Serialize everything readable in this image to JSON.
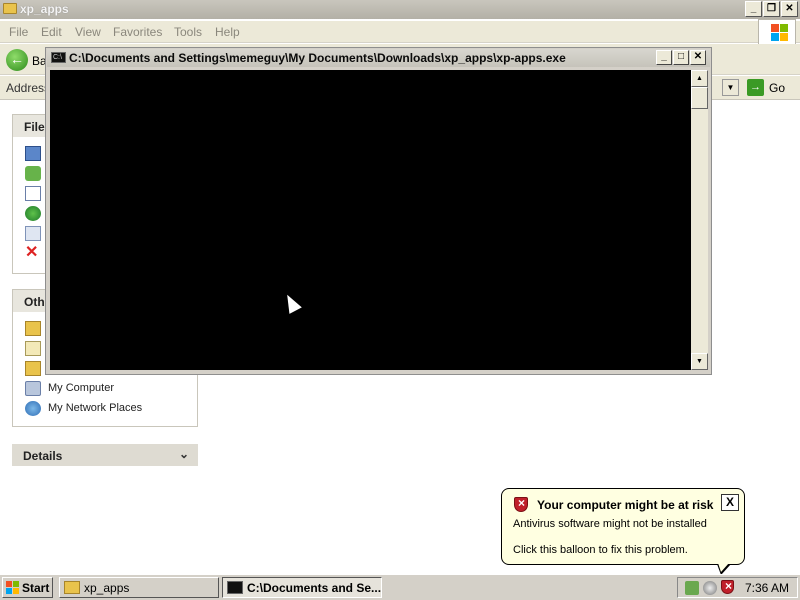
{
  "explorer": {
    "title": "xp_apps",
    "menu": [
      "File",
      "Edit",
      "View",
      "Favorites",
      "Tools",
      "Help"
    ],
    "toolbar": {
      "back_label": "Ba"
    },
    "address": {
      "label": "Address",
      "go_label": "Go"
    },
    "task_pane": {
      "file_tasks_header": "File",
      "other_places_header": "Oth",
      "other_places_items": [
        "My Computer",
        "My Network Places"
      ],
      "details_header": "Details"
    }
  },
  "console": {
    "title": "C:\\Documents and Settings\\memeguy\\My Documents\\Downloads\\xp_apps\\xp-apps.exe",
    "icon_text": "C:\\"
  },
  "balloon": {
    "title": "Your computer might be at risk",
    "line1": "Antivirus software might not be installed",
    "line2": "Click this balloon to fix this problem.",
    "close": "X"
  },
  "taskbar": {
    "start_label": "Start",
    "tasks": [
      {
        "label": "xp_apps"
      },
      {
        "label": "C:\\Documents and Se..."
      }
    ],
    "clock": "7:36 AM"
  },
  "colors": {
    "console_bg": "#000000",
    "balloon_bg": "#ffffe1",
    "taskbar_bg": "#d4d0c8",
    "security_red": "#c0202a"
  }
}
